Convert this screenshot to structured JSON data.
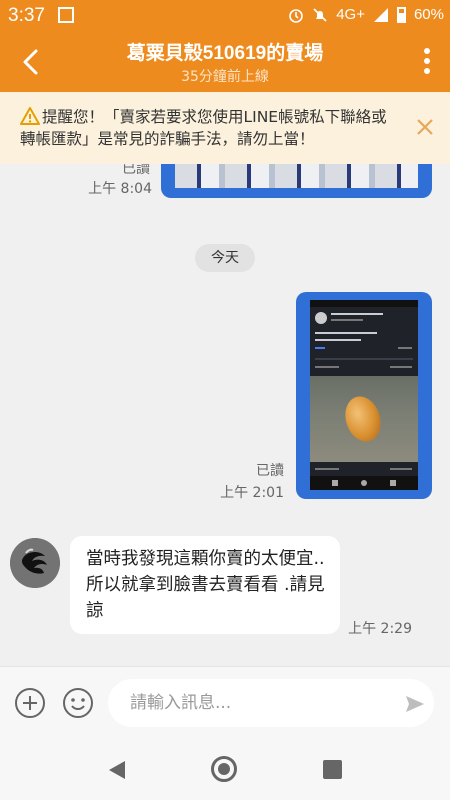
{
  "status_bar": {
    "time": "3:37",
    "network": "4G+",
    "battery": "60%",
    "icons": [
      "alarm-icon",
      "mute-icon",
      "signal-icon",
      "battery-icon"
    ]
  },
  "header": {
    "title": "葛粟貝殼510619的賣場",
    "subtitle": "35分鐘前上線"
  },
  "warning": {
    "text": "提醒您！「賣家若要求您使用LINE帳號私下聯絡或轉帳匯款」是常見的詐騙手法，請勿上當！"
  },
  "messages": {
    "prev": {
      "read": "已讀",
      "time": "上午 8:04"
    },
    "date_divider": "今天",
    "image": {
      "read": "已讀",
      "time": "上午 2:01"
    },
    "reply": {
      "text": "當時我發現這顆你賣的太便宜..所以就拿到臉書去賣看看 .請見諒",
      "time": "上午 2:29"
    }
  },
  "input": {
    "placeholder": "請輸入訊息..."
  },
  "colors": {
    "brand": "#ee8b1f",
    "warning_bg": "#fbf1dd",
    "sent_bubble": "#2f6fd6"
  }
}
